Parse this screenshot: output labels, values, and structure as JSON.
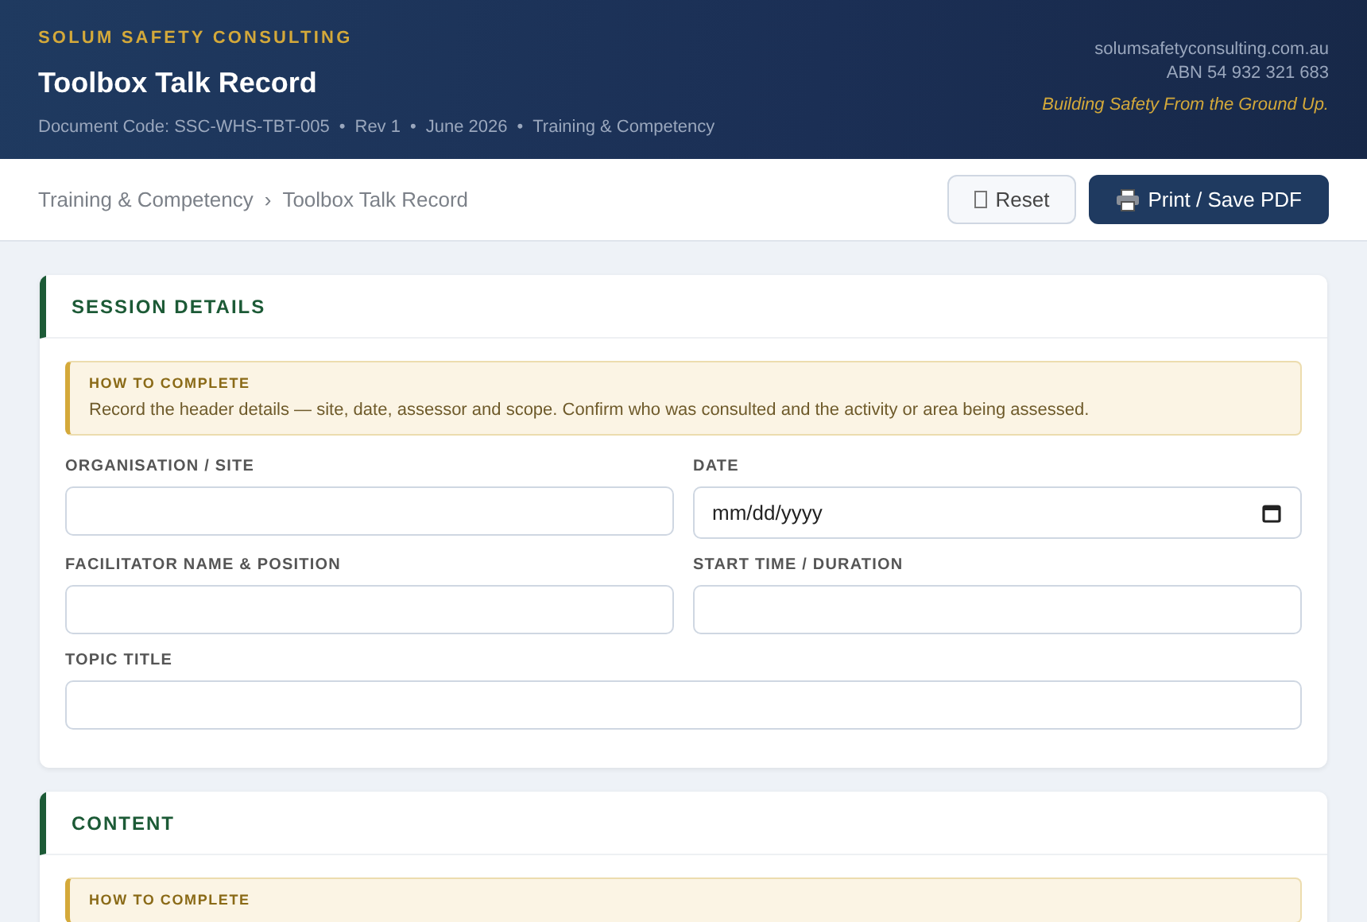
{
  "header": {
    "company": "SOLUM SAFETY CONSULTING",
    "title": "Toolbox Talk Record",
    "meta_separator": "•",
    "meta": [
      "Document Code: SSC-WHS-TBT-005",
      "Rev 1",
      "June 2026",
      "Training & Competency"
    ],
    "website": "solumsafetyconsulting.com.au",
    "abn": "ABN 54 932 321 683",
    "tagline": "Building Safety From the Ground Up."
  },
  "breadcrumb": [
    "Training & Competency",
    "Toolbox Talk Record"
  ],
  "breadcrumb_separator": "›",
  "buttons": [
    {
      "label": "Reset",
      "kind": "secondary"
    },
    {
      "label": "Print / Save PDF",
      "kind": "primary"
    }
  ],
  "sections": [
    {
      "title": "SESSION DETAILS",
      "hint": {
        "title": "HOW TO COMPLETE",
        "text": "Record the header details — site, date, assessor and scope. Confirm who was consulted and the activity or area being assessed."
      },
      "fields": [
        {
          "label": "ORGANISATION / SITE",
          "kind": "text"
        },
        {
          "label": "DATE",
          "kind": "date",
          "placeholder": "mm/dd/yyyy"
        },
        {
          "label": "FACILITATOR NAME & POSITION",
          "kind": "text"
        },
        {
          "label": "START TIME / DURATION",
          "kind": "text"
        },
        {
          "label": "TOPIC TITLE",
          "kind": "text"
        }
      ]
    },
    {
      "title": "CONTENT",
      "hint": {
        "title": "HOW TO COMPLETE"
      }
    }
  ]
}
